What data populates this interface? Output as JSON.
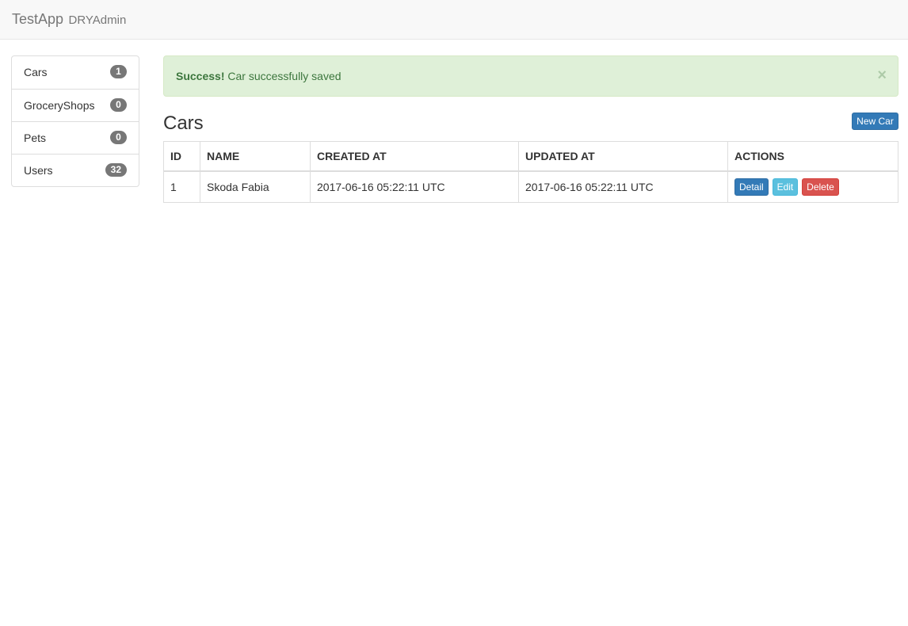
{
  "navbar": {
    "brand": "TestApp",
    "subtitle": "DRYAdmin"
  },
  "sidebar": {
    "items": [
      {
        "label": "Cars",
        "count": "1"
      },
      {
        "label": "GroceryShops",
        "count": "0"
      },
      {
        "label": "Pets",
        "count": "0"
      },
      {
        "label": "Users",
        "count": "32"
      }
    ]
  },
  "alert": {
    "strong": "Success!",
    "message": "Car successfully saved",
    "close": "×"
  },
  "page": {
    "title": "Cars",
    "new_button": "New Car"
  },
  "table": {
    "headers": [
      "ID",
      "NAME",
      "CREATED AT",
      "UPDATED AT",
      "ACTIONS"
    ],
    "rows": [
      {
        "id": "1",
        "name": "Skoda Fabia",
        "created_at": "2017-06-16 05:22:11 UTC",
        "updated_at": "2017-06-16 05:22:11 UTC",
        "actions": [
          "Detail",
          "Edit",
          "Delete"
        ]
      }
    ]
  },
  "colors": {
    "primary": "#337ab7",
    "info": "#5bc0de",
    "danger": "#d9534f",
    "success_bg": "#dff0d8",
    "badge": "#777777"
  }
}
